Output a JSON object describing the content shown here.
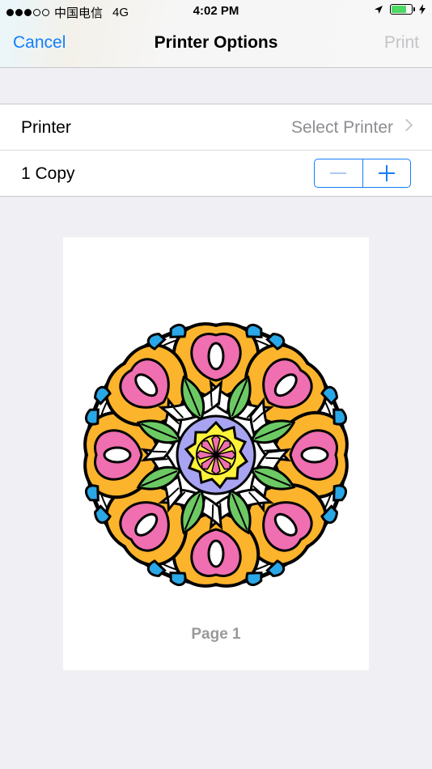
{
  "status_bar": {
    "carrier": "中国电信",
    "network": "4G",
    "time": "4:02 PM"
  },
  "nav": {
    "cancel_label": "Cancel",
    "title": "Printer Options",
    "print_label": "Print"
  },
  "options": {
    "printer_label": "Printer",
    "printer_value": "Select Printer",
    "copies_label": "1 Copy"
  },
  "preview": {
    "page_label": "Page 1"
  },
  "colors": {
    "accent": "#147efb",
    "battery": "#4cd964"
  }
}
